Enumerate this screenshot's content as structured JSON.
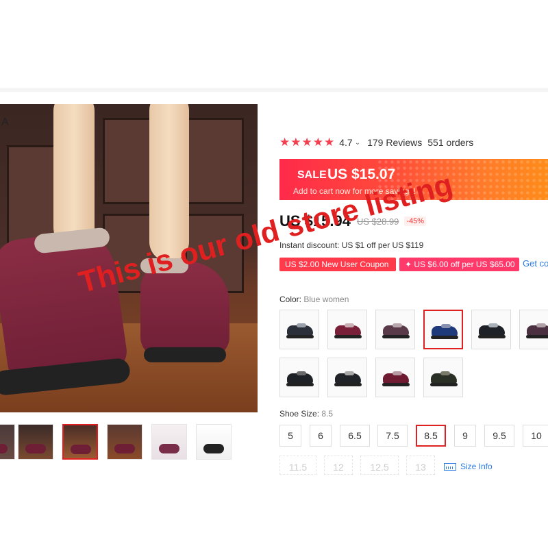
{
  "gallery": {
    "corner_label": "A",
    "thumbnails": [
      {
        "name": "thumb-1",
        "selected": false
      },
      {
        "name": "thumb-2",
        "selected": false
      },
      {
        "name": "thumb-3",
        "selected": true
      },
      {
        "name": "thumb-4",
        "selected": false
      },
      {
        "name": "thumb-5",
        "selected": false
      },
      {
        "name": "thumb-6",
        "selected": false
      }
    ]
  },
  "rating": {
    "stars": 5,
    "score": "4.7",
    "reviews": "179 Reviews",
    "orders": "551 orders"
  },
  "sale": {
    "label": "SALE",
    "price": "US $15.07",
    "subtext": "Add to cart now for more savings!"
  },
  "price": {
    "current": "US $15.94",
    "original": "US $28.99",
    "discount": "-45%"
  },
  "instant_discount": "Instant discount: US $1 off per US $119",
  "coupons": [
    "US $2.00 New User Coupon",
    "✦ US $6.00 off per US $65.00"
  ],
  "get_coupons": "Get co",
  "color": {
    "label": "Color:",
    "value": "Blue women",
    "swatches": [
      {
        "name": "black-grey-women",
        "body": "#2a2f3a",
        "fur": "#9aa0aa",
        "selected": false
      },
      {
        "name": "wine-red-women",
        "body": "#7a1f38",
        "fur": "#c9aeb4",
        "selected": false
      },
      {
        "name": "purple-women",
        "body": "#5a3a48",
        "fur": "#b8a8ae",
        "selected": false
      },
      {
        "name": "blue-women",
        "body": "#1f3a7a",
        "fur": "#8890b0",
        "selected": true
      },
      {
        "name": "black-women",
        "body": "#1e2228",
        "fur": "#aab0b8",
        "selected": false
      },
      {
        "name": "purple-2-women",
        "body": "#4a3040",
        "fur": "#b0a0a8",
        "selected": false
      },
      {
        "name": "black-men",
        "body": "#1f2226",
        "fur": "#6a6a6a",
        "selected": false
      },
      {
        "name": "black-2-men",
        "body": "#202428",
        "fur": "#a8a8a8",
        "selected": false
      },
      {
        "name": "wine-red-2-women",
        "body": "#6e1a30",
        "fur": "#b89aa2",
        "selected": false
      },
      {
        "name": "army-green-men",
        "body": "#2a3026",
        "fur": "#7a7a6a",
        "selected": false
      }
    ]
  },
  "shoe_size": {
    "label": "Shoe Size:",
    "value": "8.5",
    "sizes": [
      "5",
      "6",
      "6.5",
      "7.5",
      "8.5",
      "9",
      "9.5",
      "10"
    ],
    "disabled_sizes": [
      "11.5",
      "12",
      "12.5",
      "13"
    ],
    "size_info": "Size Info"
  },
  "overlay_text": "This is our old store listing"
}
